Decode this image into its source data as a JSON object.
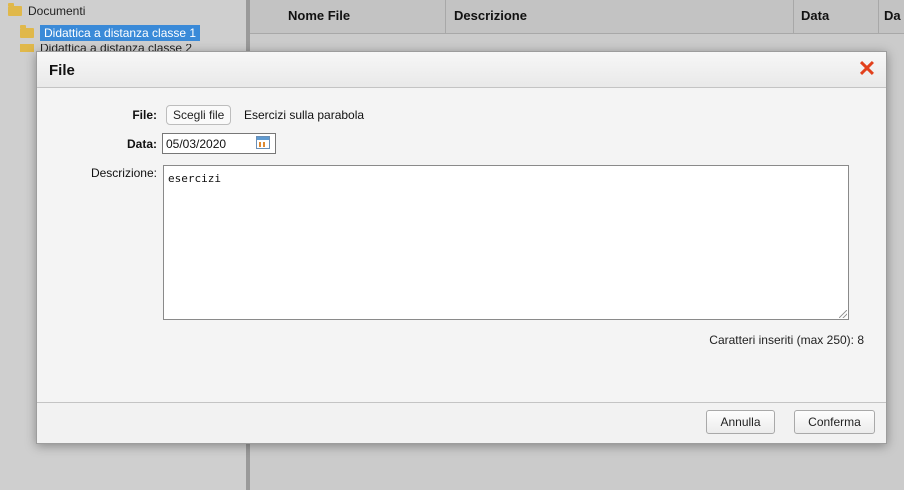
{
  "tree": {
    "root_label": "Documenti",
    "selected_item": "Didattica a distanza classe 1",
    "next_item": "Didattica a distanza classe 2"
  },
  "list": {
    "columns": [
      "Nome File",
      "Descrizione",
      "Data",
      "Da"
    ]
  },
  "modal": {
    "title": "File",
    "file_label": "File:",
    "file_button": "Scegli file",
    "file_name": "Esercizi sulla parabola",
    "date_label": "Data:",
    "date_value": "05/03/2020",
    "description_label": "Descrizione:",
    "description_value": "esercizi",
    "counter_text": "Caratteri inseriti (max 250): 8",
    "cancel_label": "Annulla",
    "confirm_label": "Conferma",
    "close_icon": "close-icon",
    "close_color": "#e2401c"
  }
}
